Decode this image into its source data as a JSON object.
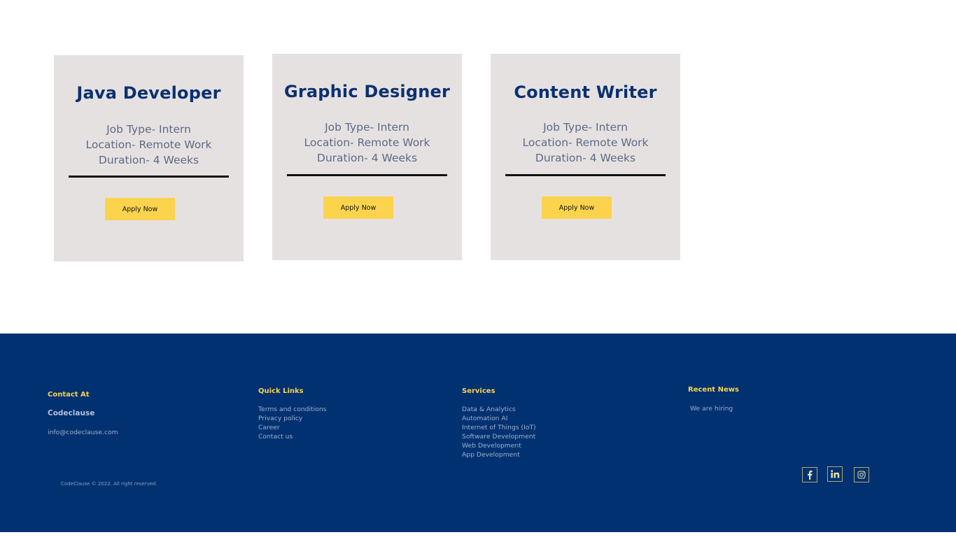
{
  "jobs": [
    {
      "title": "Java Developer",
      "job_type": "Job Type- Intern",
      "location": "Location- Remote Work",
      "duration": "Duration- 4 Weeks",
      "apply_label": "Apply Now"
    },
    {
      "title": "Graphic Designer",
      "job_type": "Job Type- Intern",
      "location": "Location- Remote Work",
      "duration": "Duration- 4 Weeks",
      "apply_label": "Apply Now"
    },
    {
      "title": "Content Writer",
      "job_type": "Job Type- Intern",
      "location": "Location- Remote Work",
      "duration": "Duration- 4 Weeks",
      "apply_label": "Apply Now"
    }
  ],
  "footer": {
    "contact": {
      "heading": "Contact At",
      "company": "Codeclause",
      "email": "info@codeclause.com"
    },
    "quick_links": {
      "heading": "Quick Links",
      "items": [
        "Terms and conditions",
        "Privacy policy",
        "Career",
        "Contact us"
      ]
    },
    "services": {
      "heading": "Services",
      "items": [
        "Data & Analytics",
        "Automation AI",
        "Internet of Things (IoT)",
        "Software Development",
        "Web Development",
        "App Development"
      ]
    },
    "recent_news": {
      "heading": "Recent News",
      "items": [
        "We are hiring"
      ]
    },
    "copyright": "CodeClause © 2022. All right reserved.",
    "social_icons": [
      "facebook-icon",
      "linkedin-icon",
      "instagram-icon"
    ]
  },
  "colors": {
    "card_bg": "#e6e1e1",
    "title": "#0b3170",
    "button": "#fcd34d",
    "footer_bg": "#013171",
    "footer_heading": "#f7d44b"
  }
}
